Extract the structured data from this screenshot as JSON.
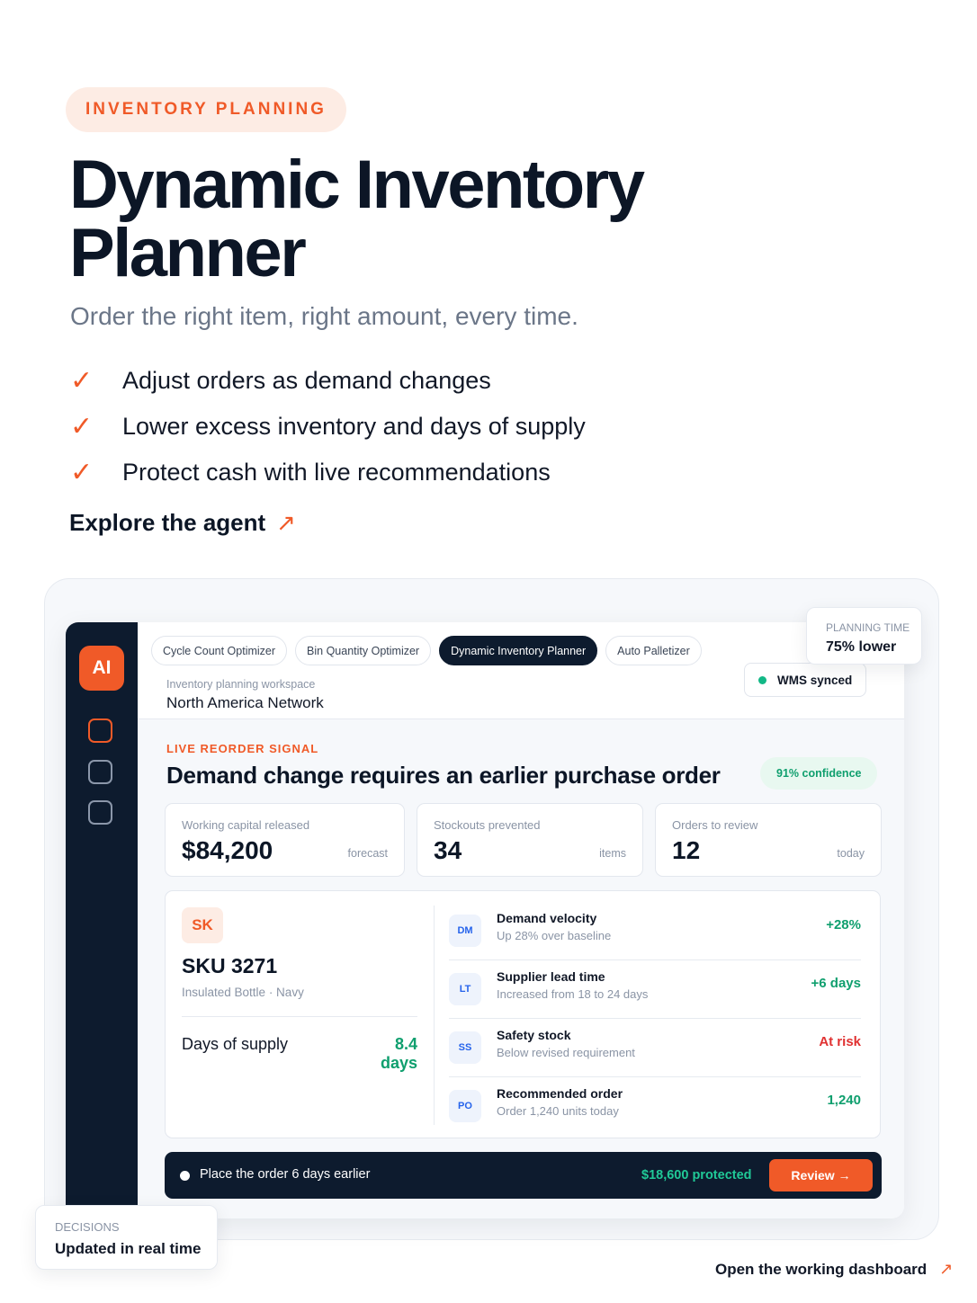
{
  "hero": {
    "eyebrow": "INVENTORY PLANNING",
    "title": "Dynamic Inventory Planner",
    "subtitle": "Order the right item, right amount, every time.",
    "benefits": [
      "Adjust orders as demand changes",
      "Lower excess inventory and days of supply",
      "Protect cash with live recommendations"
    ],
    "cta": "Explore the agent",
    "check_glyph": "✓",
    "arrow_glyph": "↗"
  },
  "sidebar": {
    "badge": "AI",
    "icons": [
      "grid-icon",
      "list-icon",
      "chart-icon"
    ]
  },
  "tabs": [
    {
      "label": "Cycle Count Optimizer",
      "active": false
    },
    {
      "label": "Bin Quantity Optimizer",
      "active": false
    },
    {
      "label": "Dynamic Inventory Planner",
      "active": true
    },
    {
      "label": "Auto Palletizer",
      "active": false
    }
  ],
  "workspace": {
    "label": "Inventory planning workspace",
    "name": "North America Network",
    "sync_status": "WMS synced"
  },
  "signal": {
    "label": "LIVE REORDER SIGNAL",
    "title": "Demand change requires an earlier purchase order",
    "confidence": "91% confidence"
  },
  "metrics": [
    {
      "label": "Working capital released",
      "value": "$84,200",
      "unit": "forecast"
    },
    {
      "label": "Stockouts prevented",
      "value": "34",
      "unit": "items"
    },
    {
      "label": "Orders to review",
      "value": "12",
      "unit": "today"
    }
  ],
  "sku": {
    "badge": "SK",
    "id": "SKU 3271",
    "description": "Insulated Bottle · Navy",
    "dos_label": "Days of supply",
    "dos_value": "8.4 days"
  },
  "factors": [
    {
      "code": "DM",
      "title": "Demand velocity",
      "subtitle": "Up 28% over baseline",
      "value": "+28%",
      "tone": "green"
    },
    {
      "code": "LT",
      "title": "Supplier lead time",
      "subtitle": "Increased from 18 to 24 days",
      "value": "+6 days",
      "tone": "green"
    },
    {
      "code": "SS",
      "title": "Safety stock",
      "subtitle": "Below revised requirement",
      "value": "At risk",
      "tone": "red"
    },
    {
      "code": "PO",
      "title": "Recommended order",
      "subtitle": "Order 1,240 units today",
      "value": "1,240",
      "tone": "green"
    }
  ],
  "action": {
    "text": "Place the order 6 days earlier",
    "protected": "$18,600 protected",
    "button": "Review →"
  },
  "planning_card": {
    "label": "PLANNING TIME",
    "value": "75% lower"
  },
  "decisions_card": {
    "label": "DECISIONS",
    "value": "Updated in real time"
  },
  "footer": {
    "link": "Open the working dashboard"
  },
  "colors": {
    "accent": "#f05a28",
    "navy": "#0d1b2e",
    "success": "#0f9f6e",
    "danger": "#e03131"
  }
}
